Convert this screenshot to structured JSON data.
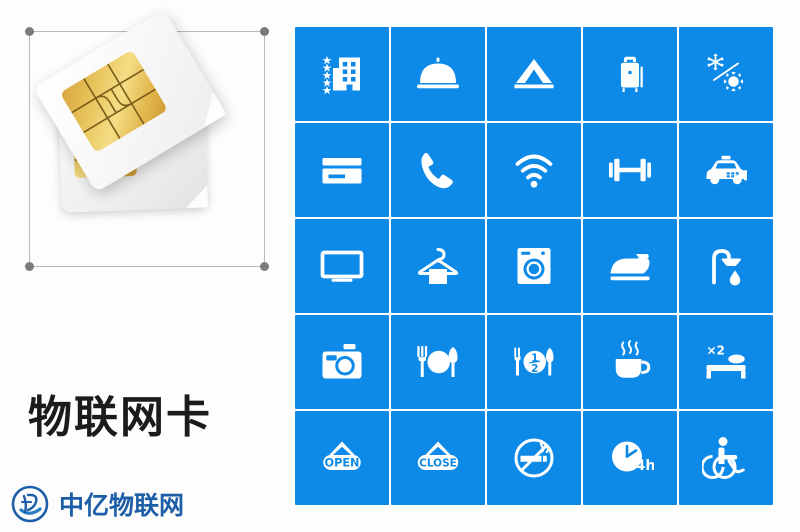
{
  "page": {
    "background_color": "#fefefe",
    "accent_blue": "#0d8ae8",
    "logo_blue": "#1c5fa8"
  },
  "left_panel": {
    "product_title": "物联网卡",
    "image": {
      "name": "sim-card-photo",
      "description": "两张白色SIM卡叠放，金色芯片",
      "selection_frame": {
        "handles": [
          "top-left",
          "top-right",
          "bottom-left",
          "bottom-right"
        ],
        "border_color": "#b9b9b9",
        "handle_color": "#7b7b7b"
      }
    },
    "watermark": {
      "logo_name": "zhongyi-logo-icon",
      "text": "中亿物联网",
      "color": "#1c5fa8"
    }
  },
  "icon_grid": {
    "columns": 5,
    "rows": 5,
    "tile_color": "#0d8ae8",
    "icon_color": "#ffffff",
    "tiles": [
      {
        "name": "hotel-stars-icon",
        "label": "五星酒店"
      },
      {
        "name": "room-service-bell-icon",
        "label": "客房服务"
      },
      {
        "name": "tent-icon",
        "label": "帐篷露营"
      },
      {
        "name": "luggage-icon",
        "label": "行李寄存"
      },
      {
        "name": "air-conditioning-icon",
        "label": "冷暖空调"
      },
      {
        "name": "credit-card-icon",
        "label": "刷卡支付"
      },
      {
        "name": "phone-icon",
        "label": "电话"
      },
      {
        "name": "wifi-icon",
        "label": "无线网络"
      },
      {
        "name": "dumbbell-icon",
        "label": "健身房"
      },
      {
        "name": "taxi-icon",
        "label": "出租车"
      },
      {
        "name": "television-icon",
        "label": "电视"
      },
      {
        "name": "clothes-hanger-icon",
        "label": "衣架洗衣"
      },
      {
        "name": "washing-machine-icon",
        "label": "洗衣机"
      },
      {
        "name": "iron-icon",
        "label": "熨斗"
      },
      {
        "name": "shower-icon",
        "label": "淋浴"
      },
      {
        "name": "camera-icon",
        "label": "相机"
      },
      {
        "name": "restaurant-icon",
        "label": "餐厅"
      },
      {
        "name": "half-board-icon",
        "label": "半膳",
        "badge": "1/2"
      },
      {
        "name": "coffee-cup-icon",
        "label": "咖啡"
      },
      {
        "name": "double-bed-icon",
        "label": "双床",
        "badge": "×2"
      },
      {
        "name": "open-sign-icon",
        "label": "营业中",
        "badge": "OPEN"
      },
      {
        "name": "close-sign-icon",
        "label": "已打烊",
        "badge": "CLOSE"
      },
      {
        "name": "no-smoking-icon",
        "label": "禁止吸烟"
      },
      {
        "name": "clock-24h-icon",
        "label": "24小时",
        "badge": "24h"
      },
      {
        "name": "wheelchair-icon",
        "label": "无障碍"
      }
    ]
  }
}
